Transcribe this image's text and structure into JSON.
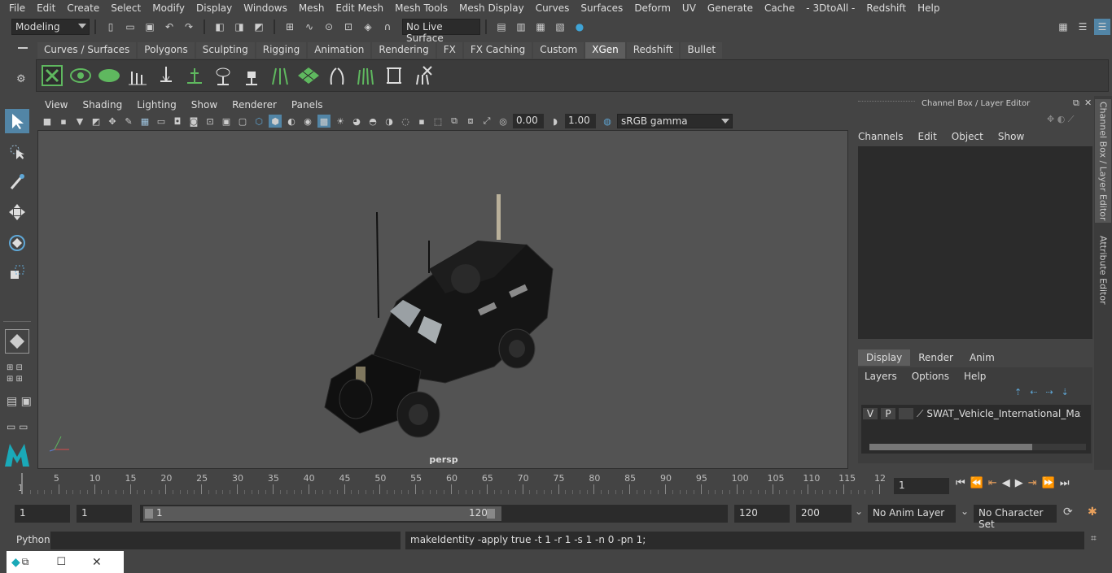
{
  "menubar": [
    "File",
    "Edit",
    "Create",
    "Select",
    "Modify",
    "Display",
    "Windows",
    "Mesh",
    "Edit Mesh",
    "Mesh Tools",
    "Mesh Display",
    "Curves",
    "Surfaces",
    "Deform",
    "UV",
    "Generate",
    "Cache",
    "- 3DtoAll -",
    "Redshift",
    "Help"
  ],
  "status": {
    "mode": "Modeling",
    "live_surface": "No Live Surface"
  },
  "shelf_tabs": [
    "Curves / Surfaces",
    "Polygons",
    "Sculpting",
    "Rigging",
    "Animation",
    "Rendering",
    "FX",
    "FX Caching",
    "Custom",
    "XGen",
    "Redshift",
    "Bullet"
  ],
  "shelf_active": "XGen",
  "viewport": {
    "menu": [
      "View",
      "Shading",
      "Lighting",
      "Show",
      "Renderer",
      "Panels"
    ],
    "exposure": "0.00",
    "gamma": "1.00",
    "color_space": "sRGB gamma",
    "camera": "persp"
  },
  "channel_box": {
    "title": "Channel Box / Layer Editor",
    "menu": [
      "Channels",
      "Edit",
      "Object",
      "Show"
    ],
    "layer_tabs": [
      "Display",
      "Render",
      "Anim"
    ],
    "layer_menu": [
      "Layers",
      "Options",
      "Help"
    ],
    "layer": {
      "v": "V",
      "p": "P",
      "name": "SWAT_Vehicle_International_MaxxPro"
    }
  },
  "side_tabs": [
    "Channel Box / Layer Editor",
    "Attribute Editor"
  ],
  "timeline": {
    "ticks": [
      "5",
      "10",
      "15",
      "20",
      "25",
      "30",
      "35",
      "40",
      "45",
      "50",
      "55",
      "60",
      "65",
      "70",
      "75",
      "80",
      "85",
      "90",
      "95",
      "100",
      "105",
      "110",
      "115",
      "12"
    ],
    "start_marker": "1",
    "current_frame": "1"
  },
  "range": {
    "start": "1",
    "anim_start": "1",
    "slider_start": "1",
    "slider_end": "120",
    "end": "120",
    "anim_end": "200",
    "anim_layer": "No Anim Layer",
    "char_set": "No Character Set"
  },
  "command": {
    "lang": "Python",
    "output": "makeIdentity -apply true -t 1 -r 1 -s 1 -n 0 -pn 1;"
  },
  "colors": {
    "accent": "#5285a6",
    "xgen_green": "#5fb85f",
    "active_tab": "#5d5d5d"
  }
}
